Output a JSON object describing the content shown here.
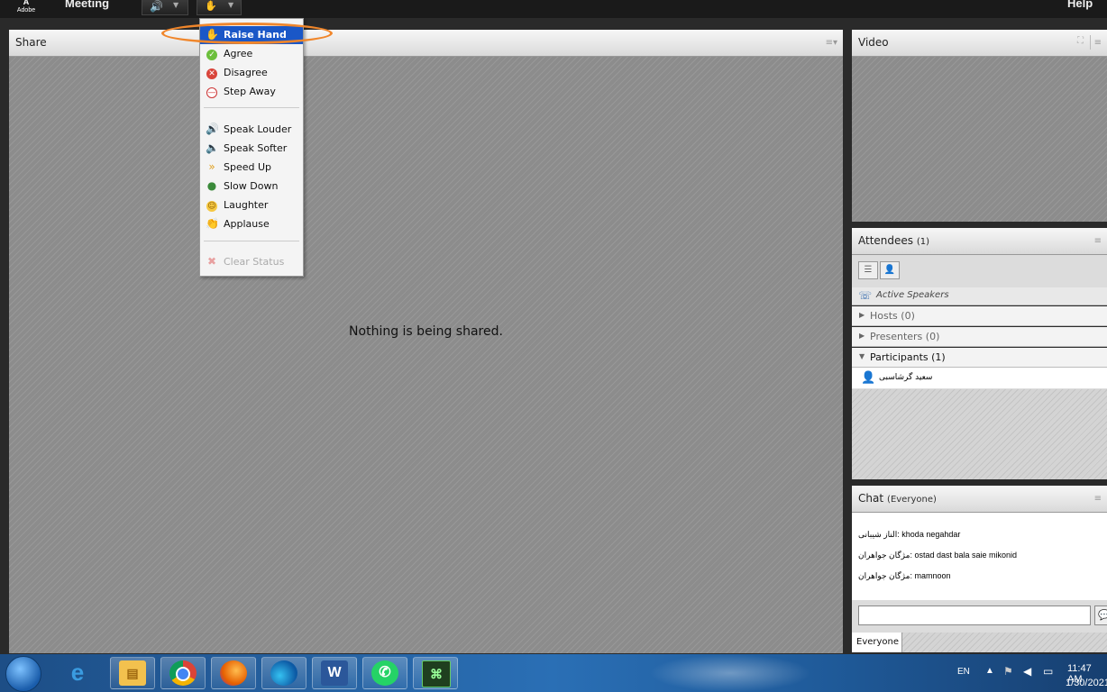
{
  "app": {
    "logo_text": "Adobe",
    "menu_meeting": "Meeting",
    "menu_help": "Help"
  },
  "status_menu": {
    "items": [
      {
        "label": "Raise Hand",
        "icon": "raise-hand-icon",
        "selected": true
      },
      {
        "label": "Agree",
        "icon": "agree-icon"
      },
      {
        "label": "Disagree",
        "icon": "disagree-icon"
      },
      {
        "label": "Step Away",
        "icon": "step-away-icon"
      },
      {
        "label": "Speak Louder",
        "icon": "speak-louder-icon"
      },
      {
        "label": "Speak Softer",
        "icon": "speak-softer-icon"
      },
      {
        "label": "Speed Up",
        "icon": "speed-up-icon"
      },
      {
        "label": "Slow Down",
        "icon": "slow-down-icon"
      },
      {
        "label": "Laughter",
        "icon": "laughter-icon"
      },
      {
        "label": "Applause",
        "icon": "applause-icon"
      },
      {
        "label": "Clear Status",
        "icon": "clear-status-icon",
        "disabled": true
      }
    ]
  },
  "share": {
    "title": "Share",
    "empty_message": "Nothing is being shared."
  },
  "video": {
    "title": "Video"
  },
  "attendees": {
    "title": "Attendees",
    "count": "(1)",
    "active_speakers": "Active Speakers",
    "groups": [
      {
        "label": "Hosts (0)",
        "expanded": false
      },
      {
        "label": "Presenters (0)",
        "expanded": false
      },
      {
        "label": "Participants (1)",
        "expanded": true
      }
    ],
    "participants": [
      "سعید گرشاسبی"
    ]
  },
  "chat": {
    "title": "Chat",
    "scope": "(Everyone)",
    "messages": [
      {
        "sender": "الناز شیبانی",
        "text": "khoda negahdar"
      },
      {
        "sender": "مژگان جواهران",
        "text": "ostad  dast bala saie mikonid"
      },
      {
        "sender": "مژگان جواهران",
        "text": "mamnoon"
      }
    ],
    "input_value": "",
    "tab_label": "Everyone"
  },
  "taskbar": {
    "language": "EN",
    "time": "11:47 AM",
    "date": "1/30/2021"
  },
  "colors": {
    "menu_selected": "#1a57c7",
    "highlight_ring": "#f0862b",
    "taskbar": "#2a6fb5"
  }
}
